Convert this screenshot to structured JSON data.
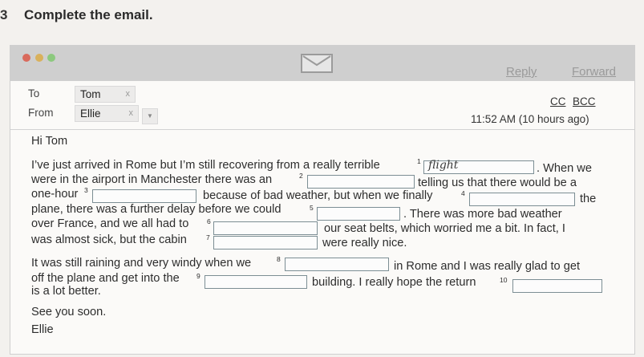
{
  "exercise": {
    "number": "3",
    "title": "Complete the email."
  },
  "titlebar": {
    "reply_label": "Reply",
    "forward_label": "Forward"
  },
  "header": {
    "to_label": "To",
    "from_label": "From",
    "to_value": "Tom",
    "from_value": "Ellie",
    "remove_symbol": "x",
    "cc_label": "CC",
    "bcc_label": "BCC",
    "time": "11:52 AM (10 hours ago)"
  },
  "email": {
    "greeting": "Hi Tom",
    "p1": {
      "l1a": "I’ve just arrived in Rome but I’m still recovering from a really terrible",
      "l1b": ". When we",
      "l2a": "were in the airport in Manchester there was an",
      "l2b": "telling us that there would be a",
      "l3a": "one-hour",
      "l3b": "because of bad weather, but when we finally",
      "l3c": "the",
      "l4a": "plane, there was a further delay before we could",
      "l4b": ". There was more bad weather",
      "l5a": "over France, and we all had to",
      "l5b": "our seat belts, which worried me a bit. In fact, I",
      "l6a": "was almost sick, but the cabin",
      "l6b": "were really nice."
    },
    "p2": {
      "l1a": "It was still raining and very windy when we",
      "l1b": "in Rome and I was really glad to get",
      "l2a": "off the plane and get into the",
      "l2b": "building. I really hope the return",
      "l3a": "is a lot better."
    },
    "closing": "See you soon.",
    "signature": "Ellie"
  },
  "gaps": [
    {
      "number": "1",
      "answer": "flight"
    },
    {
      "number": "2",
      "answer": ""
    },
    {
      "number": "3",
      "answer": ""
    },
    {
      "number": "4",
      "answer": ""
    },
    {
      "number": "5",
      "answer": ""
    },
    {
      "number": "6",
      "answer": ""
    },
    {
      "number": "7",
      "answer": ""
    },
    {
      "number": "8",
      "answer": ""
    },
    {
      "number": "9",
      "answer": ""
    },
    {
      "number": "10",
      "answer": ""
    }
  ]
}
